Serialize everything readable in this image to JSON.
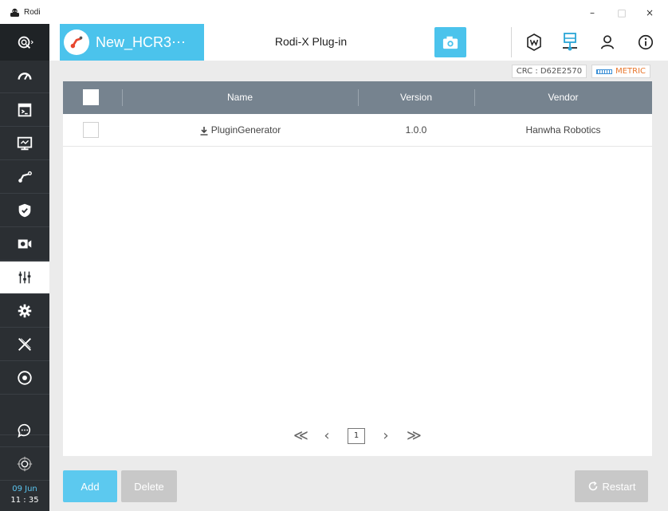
{
  "window": {
    "title": "Rodi",
    "minimize": "–",
    "maximize": "□",
    "close": "×"
  },
  "sidebar": {
    "items": [
      {
        "icon": "speed-icon"
      },
      {
        "icon": "terminal-icon"
      },
      {
        "icon": "monitor-icon"
      },
      {
        "icon": "robot-arm-icon"
      },
      {
        "icon": "shield-icon"
      },
      {
        "icon": "camera-record-icon"
      },
      {
        "icon": "sliders-icon",
        "active": true
      },
      {
        "icon": "gear-icon"
      },
      {
        "icon": "rodi-x-icon"
      },
      {
        "icon": "disc-icon"
      },
      {
        "icon": "chat-icon"
      },
      {
        "icon": "target-icon"
      }
    ],
    "clock": {
      "date": "09 Jun",
      "time": "11 : 35"
    }
  },
  "header": {
    "robot_name": "New_HCR3⋯",
    "page_title": "Rodi-X Plug-in",
    "icons": [
      "camera-icon",
      "w-badge-icon",
      "network-icon",
      "user-icon",
      "info-icon"
    ]
  },
  "status": {
    "crc": "CRC : D62E2570",
    "metric": "METRIC"
  },
  "table": {
    "columns": {
      "name": "Name",
      "version": "Version",
      "vendor": "Vendor"
    },
    "rows": [
      {
        "name": "PluginGenerator",
        "version": "1.0.0",
        "vendor": "Hanwha Robotics"
      }
    ]
  },
  "pager": {
    "first": "≪",
    "prev": "‹",
    "page": "1",
    "next": "›",
    "last": "≫"
  },
  "buttons": {
    "add": "Add",
    "delete": "Delete",
    "restart": "Restart"
  },
  "colors": {
    "accent": "#4bc3ec",
    "sidebar": "#2b2f33",
    "table_header": "#76838f",
    "metric": "#e8772e"
  }
}
